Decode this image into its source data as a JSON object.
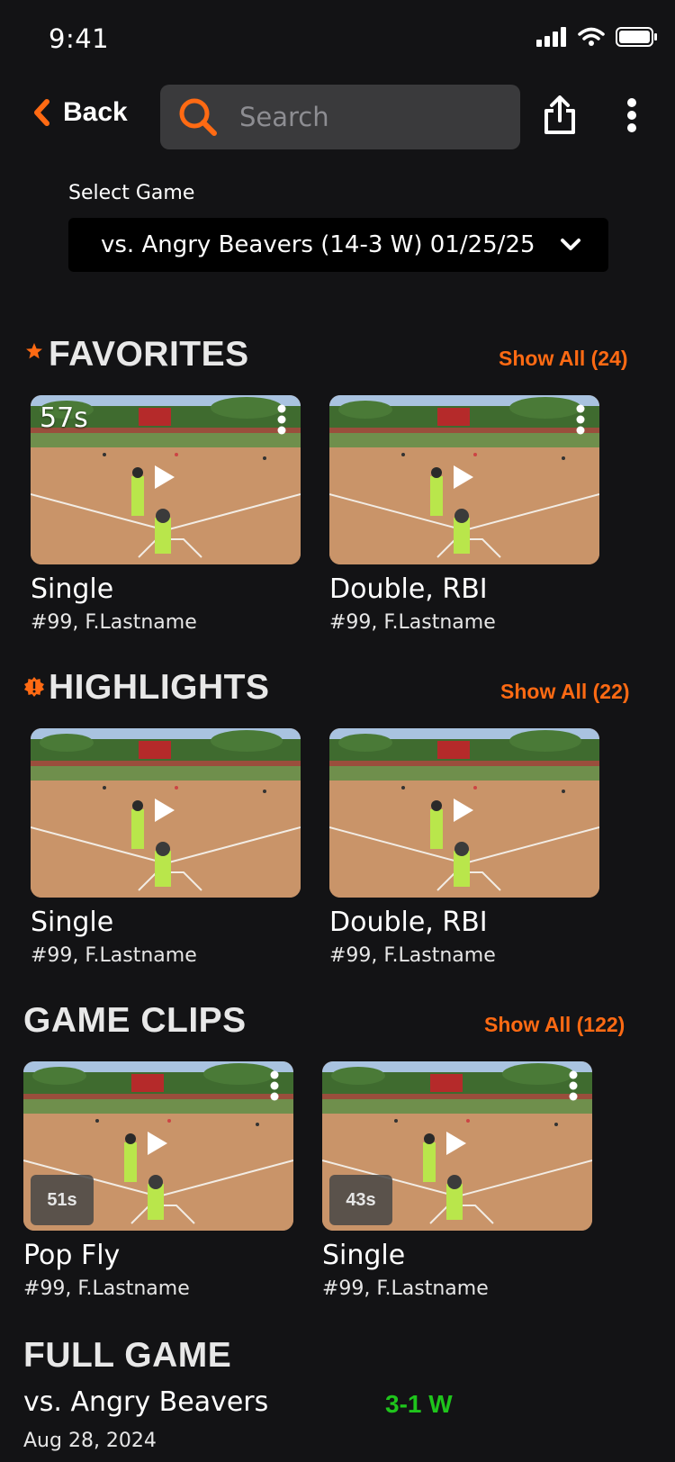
{
  "status_bar": {
    "time": "9:41"
  },
  "top_bar": {
    "back_label": "Back",
    "search_placeholder": "Search"
  },
  "select_game": {
    "label": "Select Game",
    "value": "vs. Angry Beavers (14-3 W) 01/25/25"
  },
  "colors": {
    "accent": "#ff6a13",
    "background": "#131315",
    "win": "#1fc41c"
  },
  "sections": {
    "favorites": {
      "title": "FAVORITES",
      "show_all": "Show All (24)",
      "clips": [
        {
          "title": "Single",
          "player": "#99, F.Lastname",
          "duration": "57s"
        },
        {
          "title": "Double, RBI",
          "player": "#99, F.Lastname"
        }
      ]
    },
    "highlights": {
      "title": "HIGHLIGHTS",
      "show_all": "Show All (22)",
      "clips": [
        {
          "title": "Single",
          "player": "#99, F.Lastname"
        },
        {
          "title": "Double, RBI",
          "player": "#99, F.Lastname"
        }
      ]
    },
    "game_clips": {
      "title": "GAME CLIPS",
      "show_all": "Show All (122)",
      "clips": [
        {
          "title": "Pop Fly",
          "player": "#99, F.Lastname",
          "duration": "51s"
        },
        {
          "title": "Single",
          "player": "#99, F.Lastname",
          "duration": "43s"
        }
      ]
    },
    "full_game": {
      "title": "FULL GAME",
      "opponent": "vs. Angry Beavers",
      "result": "3-1 W",
      "date": "Aug 28, 2024"
    }
  }
}
